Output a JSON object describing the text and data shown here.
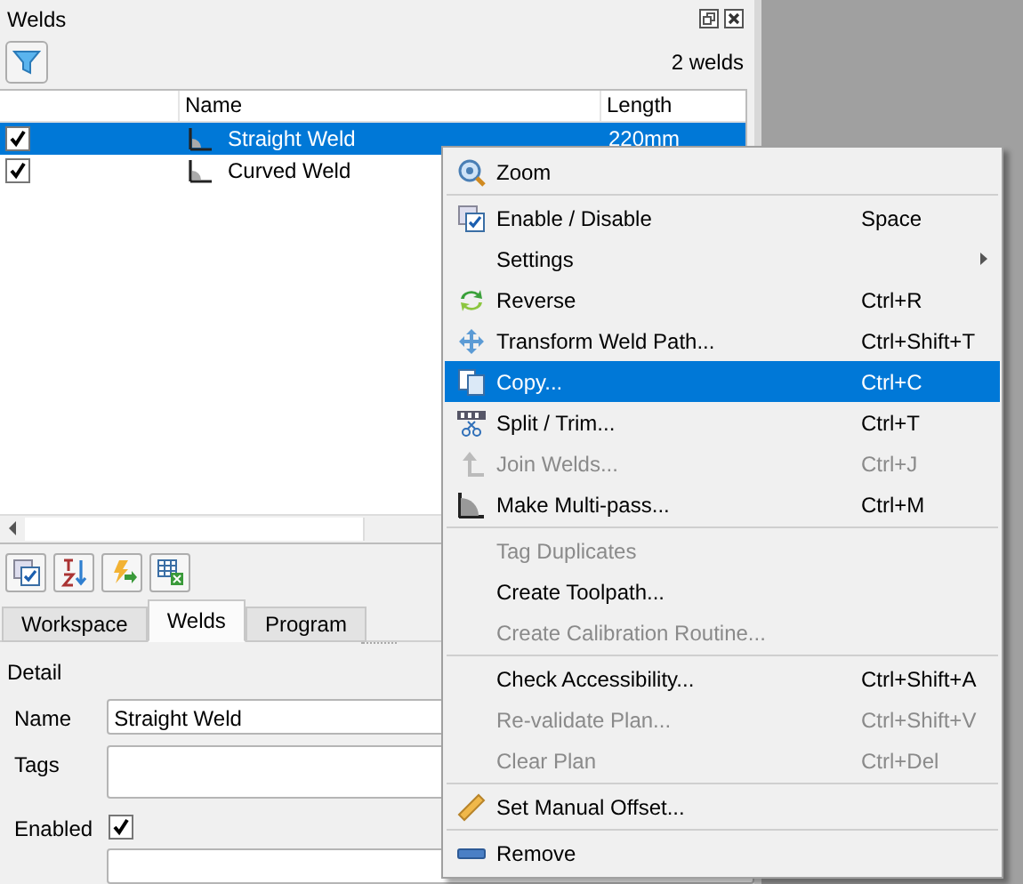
{
  "panel": {
    "title": "Welds",
    "count": "2 welds"
  },
  "table": {
    "columns": [
      "Name",
      "Length"
    ],
    "rows": [
      {
        "checked": true,
        "selected": true,
        "name": "Straight Weld",
        "length": "220mm"
      },
      {
        "checked": true,
        "selected": false,
        "name": "Curved Weld"
      }
    ]
  },
  "tabs": [
    {
      "label": "Workspace",
      "selected": false
    },
    {
      "label": "Welds",
      "selected": true
    },
    {
      "label": "Program",
      "selected": false
    }
  ],
  "detail": {
    "title": "Detail",
    "fields": [
      {
        "kind": "text",
        "label": "Name",
        "value": "Straight Weld"
      },
      {
        "kind": "textarea",
        "label": "Tags"
      },
      {
        "kind": "checkbox",
        "label": "Enabled",
        "checked": true
      },
      {
        "kind": "spin"
      }
    ]
  },
  "context_menu": [
    {
      "kind": "item",
      "label": "Zoom",
      "disabled": false,
      "selected": false
    },
    {
      "kind": "separator"
    },
    {
      "kind": "item",
      "label": "Enable / Disable",
      "shortcut": "Space",
      "disabled": false,
      "selected": false
    },
    {
      "kind": "item",
      "label": "Settings",
      "submenu": true,
      "disabled": false,
      "selected": false
    },
    {
      "kind": "item",
      "label": "Reverse",
      "shortcut": "Ctrl+R",
      "disabled": false,
      "selected": false
    },
    {
      "kind": "item",
      "label": "Transform Weld Path...",
      "shortcut": "Ctrl+Shift+T",
      "disabled": false,
      "selected": false
    },
    {
      "kind": "item",
      "label": "Copy...",
      "shortcut": "Ctrl+C",
      "disabled": false,
      "selected": true
    },
    {
      "kind": "item",
      "label": "Split / Trim...",
      "shortcut": "Ctrl+T",
      "disabled": false,
      "selected": false
    },
    {
      "kind": "item",
      "label": "Join Welds...",
      "shortcut": "Ctrl+J",
      "disabled": true,
      "selected": false
    },
    {
      "kind": "item",
      "label": "Make Multi-pass...",
      "shortcut": "Ctrl+M",
      "disabled": false,
      "selected": false
    },
    {
      "kind": "separator"
    },
    {
      "kind": "item",
      "label": "Tag Duplicates",
      "disabled": true,
      "selected": false
    },
    {
      "kind": "item",
      "label": "Create Toolpath...",
      "disabled": false,
      "selected": false
    },
    {
      "kind": "item",
      "label": "Create Calibration Routine...",
      "disabled": true,
      "selected": false
    },
    {
      "kind": "separator"
    },
    {
      "kind": "item",
      "label": "Check Accessibility...",
      "shortcut": "Ctrl+Shift+A",
      "disabled": false,
      "selected": false
    },
    {
      "kind": "item",
      "label": "Re-validate Plan...",
      "shortcut": "Ctrl+Shift+V",
      "disabled": true,
      "selected": false
    },
    {
      "kind": "item",
      "label": "Clear Plan",
      "shortcut": "Ctrl+Del",
      "disabled": true,
      "selected": false
    },
    {
      "kind": "separator"
    },
    {
      "kind": "item",
      "label": "Set Manual Offset...",
      "disabled": false,
      "selected": false
    },
    {
      "kind": "separator"
    },
    {
      "kind": "item",
      "label": "Remove",
      "disabled": false,
      "selected": false
    }
  ]
}
